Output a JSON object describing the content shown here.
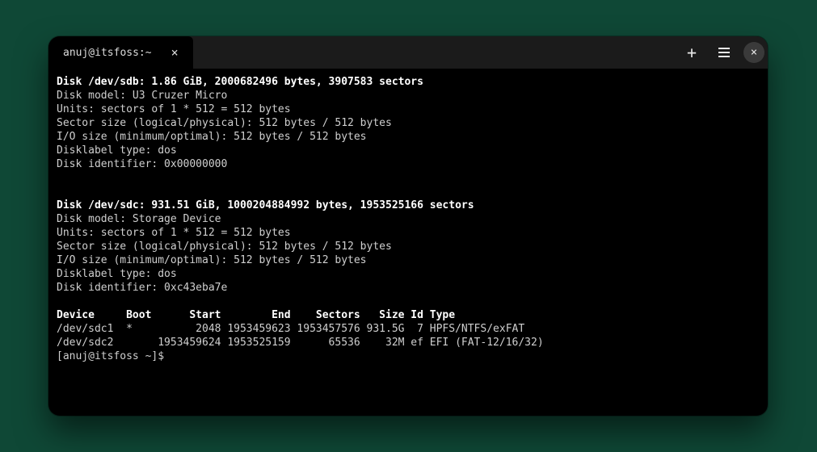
{
  "tab": {
    "title": "anuj@itsfoss:~",
    "close_glyph": "×"
  },
  "titlebar": {
    "new_tab_glyph": "+",
    "close_glyph": "×"
  },
  "disk_sdb": {
    "header": "Disk /dev/sdb: 1.86 GiB, 2000682496 bytes, 3907583 sectors",
    "model": "Disk model: U3 Cruzer Micro ",
    "units": "Units: sectors of 1 * 512 = 512 bytes",
    "sector_size": "Sector size (logical/physical): 512 bytes / 512 bytes",
    "io_size": "I/O size (minimum/optimal): 512 bytes / 512 bytes",
    "label_type": "Disklabel type: dos",
    "identifier": "Disk identifier: 0x00000000"
  },
  "disk_sdc": {
    "header": "Disk /dev/sdc: 931.51 GiB, 1000204884992 bytes, 1953525166 sectors",
    "model": "Disk model: Storage Device  ",
    "units": "Units: sectors of 1 * 512 = 512 bytes",
    "sector_size": "Sector size (logical/physical): 512 bytes / 512 bytes",
    "io_size": "I/O size (minimum/optimal): 512 bytes / 512 bytes",
    "label_type": "Disklabel type: dos",
    "identifier": "Disk identifier: 0xc43eba7e"
  },
  "partitions": {
    "header": "Device     Boot      Start        End    Sectors   Size Id Type",
    "row1": "/dev/sdc1  *          2048 1953459623 1953457576 931.5G  7 HPFS/NTFS/exFAT",
    "row2": "/dev/sdc2       1953459624 1953525159      65536    32M ef EFI (FAT-12/16/32)"
  },
  "prompt": "[anuj@itsfoss ~]$ "
}
